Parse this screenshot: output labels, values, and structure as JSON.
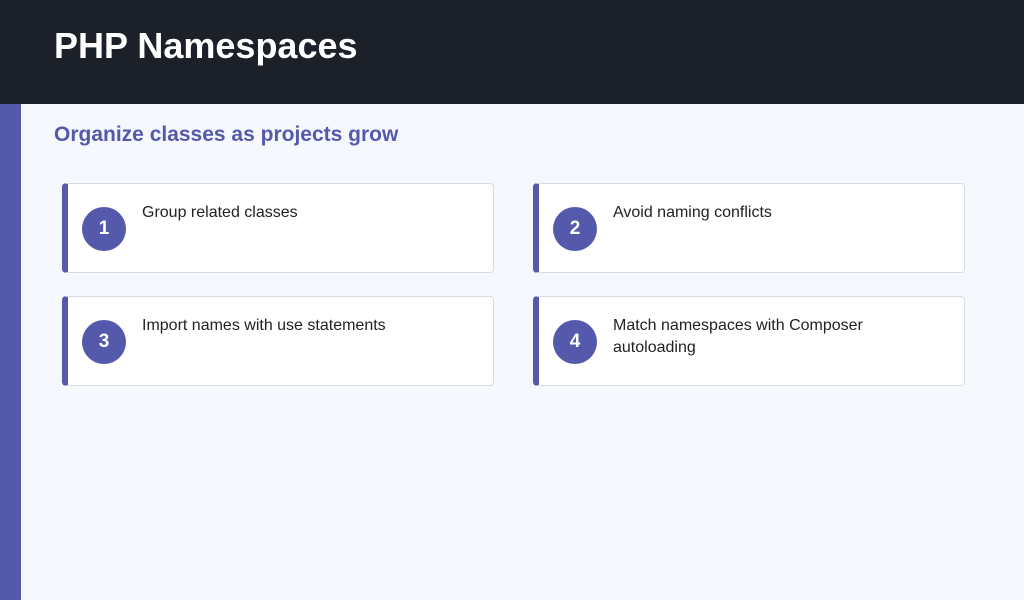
{
  "header": {
    "title": "PHP Namespaces"
  },
  "subtitle": "Organize classes as projects grow",
  "cards": [
    {
      "number": "1",
      "text": "Group related classes"
    },
    {
      "number": "2",
      "text": "Avoid naming conflicts"
    },
    {
      "number": "3",
      "text": "Import names with use statements"
    },
    {
      "number": "4",
      "text": "Match namespaces with Composer autoloading"
    }
  ],
  "colors": {
    "header_bg": "#1b2029",
    "accent": "#5559ab",
    "page_bg": "#f5f8fc",
    "card_bg": "#ffffff"
  }
}
